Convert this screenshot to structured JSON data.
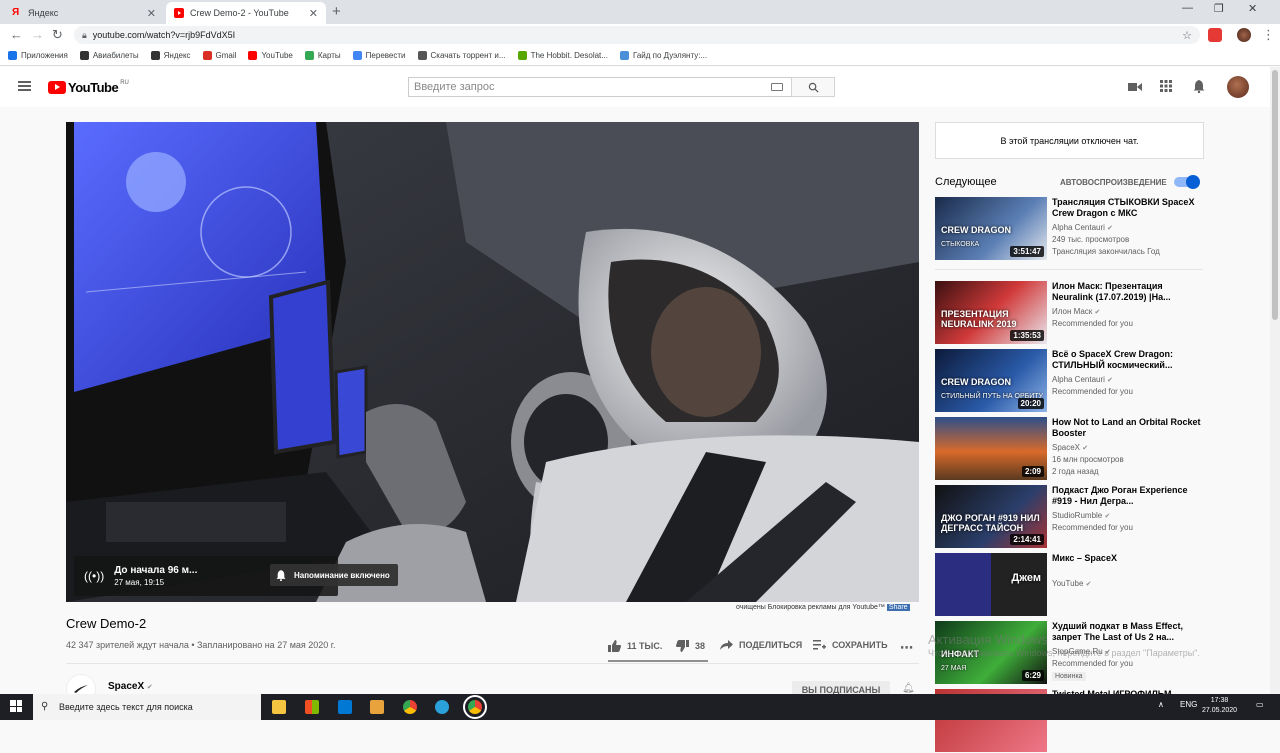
{
  "browser": {
    "tabs": [
      {
        "label": "Яндекс",
        "active": false
      },
      {
        "label": "Crew Demo-2 - YouTube",
        "active": true
      }
    ],
    "url": "youtube.com/watch?v=rjb9FdVdX5I",
    "bookmarks": [
      {
        "label": "Приложения",
        "color": "#1a73e8"
      },
      {
        "label": "Авиабилеты",
        "color": "#333333"
      },
      {
        "label": "Яндекс",
        "color": "#333333"
      },
      {
        "label": "Gmail",
        "color": "#d93025"
      },
      {
        "label": "YouTube",
        "color": "#ff0000"
      },
      {
        "label": "Карты",
        "color": "#34a853"
      },
      {
        "label": "Перевести",
        "color": "#4285f4"
      },
      {
        "label": "Скачать торрент и...",
        "color": "#555555"
      },
      {
        "label": "The Hobbit. Desolat...",
        "color": "#58a700"
      },
      {
        "label": "Гайд по Дуэлянту:...",
        "color": "#4a90d9"
      }
    ]
  },
  "youtube": {
    "logo_text": "YouTube",
    "country": "RU",
    "search_placeholder": "Введите запрос"
  },
  "player": {
    "countdown": "До начала 96 м...",
    "scheduled": "27 мая, 19:15",
    "reminder": "Напоминание включено",
    "adblock_note": "очищены Блокировка рекламы для Youtube™",
    "share_label": "Share"
  },
  "video": {
    "title": "Crew Demo-2",
    "meta": "42 347 зрителей ждут начала • Запланировано на 27 мая 2020 г.",
    "likes": "11 ТЫС.",
    "dislikes": "38",
    "like_ratio": 0.997,
    "share": "ПОДЕЛИТЬСЯ",
    "save": "СОХРАНИТЬ",
    "channel": "SpaceX",
    "subscribe": "ВЫ ПОДПИСАНЫ"
  },
  "sidebar": {
    "chat_disabled": "В этой трансляции отключен чат.",
    "up_next": "Следующее",
    "autoplay": "АВТОВОСПРОИЗВЕДЕНИЕ",
    "recs": [
      {
        "title": "Трансляция СТЫКОВКИ SpaceX Crew Dragon с МКС",
        "channel": "Alpha Centauri",
        "line2": "249 тыс. просмотров",
        "line3": "Трансляция закончилась Год",
        "duration": "3:51:47",
        "thumb_text": "CREW DRAGON",
        "thumb_sub": "СТЫКОВКА"
      },
      {
        "title": "Илон Маск: Презентация Neuralink (17.07.2019) |На...",
        "channel": "Илон Маск",
        "line2": "Recommended for you",
        "line3": "",
        "duration": "1:35:53",
        "thumb_text": "ПРЕЗЕНТАЦИЯ NEURALINK 2019",
        "thumb_sub": ""
      },
      {
        "title": "Всё о SpaceX Crew Dragon: СТИЛЬНЫЙ космический...",
        "channel": "Alpha Centauri",
        "line2": "Recommended for you",
        "line3": "",
        "duration": "20:20",
        "thumb_text": "CREW DRAGON",
        "thumb_sub": "СТИЛЬНЫЙ ПУТЬ НА ОРБИТУ"
      },
      {
        "title": "How Not to Land an Orbital Rocket Booster",
        "channel": "SpaceX",
        "line2": "16 млн просмотров",
        "line3": "2 года назад",
        "duration": "2:09",
        "thumb_text": "",
        "thumb_sub": ""
      },
      {
        "title": "Подкаст Джо Роган Experience #919 - Нил Дегра...",
        "channel": "StudioRumble",
        "line2": "Recommended for you",
        "line3": "",
        "duration": "2:14:41",
        "thumb_text": "ДЖО РОГАН #919 НИЛ ДЕГРАСС ТАЙСОН",
        "thumb_sub": ""
      },
      {
        "title": "Микс – SpaceX",
        "channel": "YouTube",
        "line2": "",
        "line3": "",
        "duration": "",
        "thumb_text": "Джем",
        "thumb_sub": ""
      },
      {
        "title": "Худший подкат в Mass Effect, запрет The Last of Us 2 на...",
        "channel": "StopGame.Ru",
        "line2": "Recommended for you",
        "line3": "Новинка",
        "duration": "6:29",
        "thumb_text": "ИНФАКТ",
        "thumb_sub": "27 МАЯ"
      },
      {
        "title": "Twisted Metal ИГРОФИЛЬМ",
        "channel": "",
        "line2": "",
        "line3": "",
        "duration": "",
        "thumb_text": "",
        "thumb_sub": ""
      }
    ],
    "activation_title": "Активация Windows",
    "activation_sub": "Чтобы активировать Windows, перейдите в раздел \"Параметры\"."
  },
  "taskbar": {
    "search_placeholder": "Введите здесь текст для поиска",
    "lang": "ENG",
    "time": "17:38",
    "date": "27.05.2020"
  },
  "colors": {
    "brand_red": "#ff0000",
    "accent_blue": "#065fd4"
  }
}
